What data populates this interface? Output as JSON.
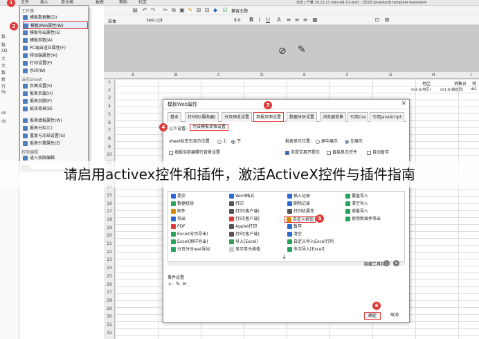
{
  "menubar": {
    "items": [
      "文件",
      "插入",
      "单元格",
      "报表",
      "帮助",
      "社区"
    ],
    "info": "日志 | 产量 10.11.11 (dev-dd-11-star) - ZZZZ [standard] template teamwork"
  },
  "toolbar": {
    "compat_label": "兼容主题",
    "file_tab": "test.cpt",
    "font_name": "宋体",
    "font_size": "9.0"
  },
  "leftpanel": {
    "items": [
      "数",
      "数",
      "SQ",
      "大",
      "大",
      "数",
      "新",
      "行",
      "fin",
      "ds",
      "ds"
    ]
  },
  "dropdown": {
    "section1": "工作簿",
    "items1": [
      "模板数据集(D)",
      "模板Web属性(W)",
      "模板导出属性(E)",
      "模板参数(A)",
      "PC端自适应属性(F)",
      "移动端属性(M)",
      "打印设置(P)",
      "水印(W)"
    ],
    "section2": "当前Sheet",
    "items2": [
      "页面设置(S)",
      "报表页眉(H)",
      "报表页脚(F)",
      "纸张背景(B)"
    ],
    "items3": [
      "报表填报属性(W)",
      "报表分栏(C)",
      "重复与冻结设置(G)",
      "报表引擎属性(E)"
    ],
    "section3": "权限编辑",
    "items4": [
      "进入权限编辑"
    ],
    "section4": "模板"
  },
  "spreadsheet": {
    "columns": [
      "A",
      "B",
      "C",
      "D",
      "E",
      "F",
      "G",
      "H",
      "I"
    ],
    "rows": [
      "1",
      "2",
      "3",
      "4",
      "5",
      "6",
      "7",
      "8",
      "9",
      "10",
      "11",
      "12",
      "13",
      "14",
      "15",
      "16",
      "17",
      "18",
      "19",
      "20",
      "21",
      "22",
      "23",
      "24",
      "25",
      "26",
      "27",
      "28",
      "29",
      "30",
      "31",
      "32"
    ],
    "cell_headers": [
      "地区",
      "销售员",
      "销",
      "ds1.G(地区)",
      "ds1.G(销售员)",
      "ds1"
    ]
  },
  "dialog": {
    "title": "模板Web属性",
    "tabs": [
      "基本",
      "打印机(服务器)",
      "分页预览设置",
      "填报页面设置",
      "数据分析设置",
      "浏览器背景",
      "引用Css",
      "引用JavaScript"
    ],
    "setting_label": "以下设置:",
    "setting_value": "为该模板单独设置",
    "sheet_pos_label": "sheet标签页显示位置:",
    "sheet_pos_top": "上",
    "sheet_pos_bottom": "下",
    "report_pos_label": "报表显示位置:",
    "report_pos_center": "居中展示",
    "report_pos_left": "左展示",
    "cb_autoload": "填报当前编辑行背景设置",
    "cb_unfilled": "未提交离开提示",
    "cb_direct": "直接显示控件",
    "cb_autosave": "自动暂存",
    "buttons": [
      [
        "提交",
        "Word格式",
        "插入记录",
        "覆盖导入"
      ],
      [
        "数据校验",
        "打印",
        "删除记录",
        "清空导入"
      ],
      [
        "邮件",
        "打印(客户端)",
        "打印机属性",
        "增量导入"
      ],
      [
        "导出",
        "打印[客户端]",
        "自定义按钮",
        "使用新插件导出"
      ],
      [
        "PDF",
        "Applet打印",
        "暂存",
        ""
      ],
      [
        "Excel(分页导出)",
        "打印[客户端]",
        "清空",
        ""
      ],
      [
        "Excel(原样导出)",
        "导入[Excel]",
        "自定义导入Excel行列",
        ""
      ],
      [
        "分页分Sheet导出",
        "显示单元格值",
        "多次导入[Excel]",
        ""
      ]
    ],
    "hide_toolbar": "隐藏工具栏",
    "event_label": "事件设置",
    "ok": "确定",
    "cancel": "取消"
  },
  "markers": [
    "1",
    "2",
    "3",
    "4",
    "5",
    "6"
  ],
  "overlay_title": "请启用activex控件和插件，激活ActiveX控件与插件指南",
  "colors": {
    "accent_red": "#e03a3a",
    "selection_blue": "#2a6bd1"
  }
}
